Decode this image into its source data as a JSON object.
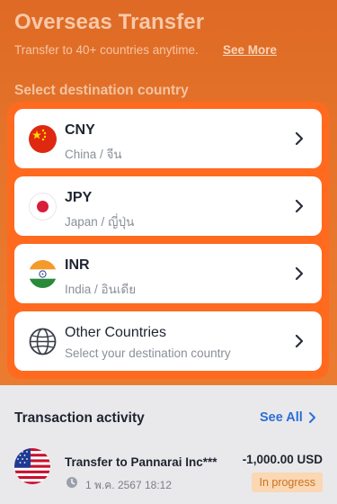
{
  "header": {
    "title": "Overseas Transfer",
    "subtitle": "Transfer to 40+ countries anytime.",
    "see_more": "See More"
  },
  "destination": {
    "section_label": "Select destination country",
    "items": [
      {
        "code": "CNY",
        "name": "China / จีน",
        "icon": "china-flag-icon"
      },
      {
        "code": "JPY",
        "name": "Japan / ญี่ปุ่น",
        "icon": "japan-flag-icon"
      },
      {
        "code": "INR",
        "name": "India / อินเดีย",
        "icon": "india-flag-icon"
      },
      {
        "code": "Other Countries",
        "name": "Select your destination country",
        "icon": "globe-icon"
      }
    ]
  },
  "activity": {
    "title": "Transaction activity",
    "see_all": "See All",
    "transactions": [
      {
        "title": "Transfer to Pannarai Inc***",
        "date": "1 พ.ค. 2567 18:12",
        "amount": "-1,000.00 USD",
        "status": "In progress",
        "icon": "usa-flag-icon"
      }
    ]
  },
  "colors": {
    "accent": "#ff6a1f",
    "header_bg": "#e6752b",
    "link": "#2b6fd6",
    "status_bg": "#fbd7b3",
    "status_text": "#c97321"
  }
}
